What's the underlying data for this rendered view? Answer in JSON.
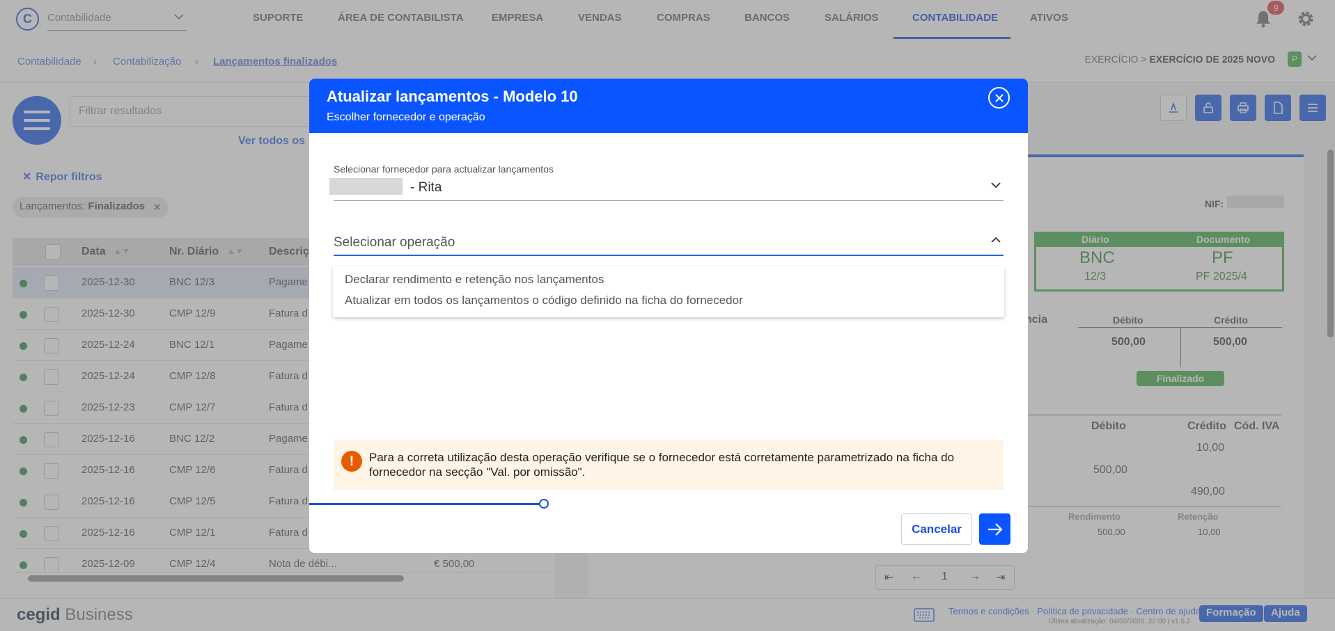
{
  "topbar": {
    "logo_letter": "C",
    "module": "Contabilidade",
    "nav": [
      "SUPORTE",
      "ÁREA DE CONTABILISTA",
      "EMPRESA",
      "VENDAS",
      "COMPRAS",
      "BANCOS",
      "SALÁRIOS",
      "CONTABILIDADE",
      "ATIVOS"
    ],
    "active_nav": "CONTABILIDADE",
    "notifications": "9"
  },
  "breadcrumb": [
    "Contabilidade",
    "Contabilização",
    "Lançamentos finalizados"
  ],
  "exercise": {
    "prefix": "EXERCÍCIO >",
    "name": "EXERCÍCIO DE 2025 NOVO",
    "badge": "P"
  },
  "left": {
    "filter_placeholder": "Filtrar resultados",
    "see_all": "Ver todos os",
    "reset_filters": "Repor filtros",
    "chip_label": "Lançamentos:",
    "chip_value": "Finalizados",
    "columns": [
      "Data",
      "Nr. Diário",
      "Descriç"
    ],
    "rows": [
      {
        "date": "2025-12-30",
        "diario": "BNC 12/3",
        "desc": "Pagame",
        "value": ""
      },
      {
        "date": "2025-12-30",
        "diario": "CMP 12/9",
        "desc": "Fatura d",
        "value": ""
      },
      {
        "date": "2025-12-24",
        "diario": "BNC 12/1",
        "desc": "Pagame",
        "value": ""
      },
      {
        "date": "2025-12-24",
        "diario": "CMP 12/8",
        "desc": "Fatura d",
        "value": ""
      },
      {
        "date": "2025-12-23",
        "diario": "CMP 12/7",
        "desc": "Fatura d",
        "value": ""
      },
      {
        "date": "2025-12-16",
        "diario": "BNC 12/2",
        "desc": "Pagame",
        "value": ""
      },
      {
        "date": "2025-12-16",
        "diario": "CMP 12/6",
        "desc": "Fatura d",
        "value": ""
      },
      {
        "date": "2025-12-16",
        "diario": "CMP 12/5",
        "desc": "Fatura d",
        "value": ""
      },
      {
        "date": "2025-12-16",
        "diario": "CMP 12/1",
        "desc": "Fatura d",
        "value": ""
      },
      {
        "date": "2025-12-09",
        "diario": "CMP 12/4",
        "desc": "Nota de débi...",
        "value": "€ 500,00"
      }
    ]
  },
  "doc": {
    "nif_label": "NIF:",
    "diario_label": "Diário",
    "documento_label": "Documento",
    "diario_code": "BNC",
    "diario_num": "12/3",
    "doc_code": "PF",
    "doc_num": "PF 2025/4",
    "ncia": "ncia",
    "debit_label": "Débito",
    "credit_label": "Crédito",
    "debit_total": "500,00",
    "credit_total": "500,00",
    "status": "Finalizado",
    "lines_debit_label": "Débito",
    "lines_credit_label": "Crédito",
    "lines_iva_label": "Cód. IVA",
    "line1_credit": "10,00",
    "line2_debit": "500,00",
    "line3_credit": "490,00",
    "rendimento_label": "Rendimento",
    "retencao_label": "Retenção",
    "rendimento_value": "500,00",
    "retencao_value": "10,00"
  },
  "pager": {
    "page": "1"
  },
  "footer": {
    "brand_bold": "cegid",
    "brand_light": "Business",
    "links": "Termos e condições · Política de privacidade · Centro de ajuda",
    "last_update": "Última atualização: 04/02/2026, 22:00 | v1.5.2",
    "training": "Formação",
    "help": "Ajuda"
  },
  "modal": {
    "title": "Atualizar lançamentos - Modelo 10",
    "subtitle": "Escolher fornecedor e operação",
    "supplier_label": "Selecionar fornecedor para actualizar lançamentos",
    "supplier_value": "- Rita",
    "operation_placeholder": "Selecionar operação",
    "options": [
      "Declarar rendimento e retenção nos lançamentos",
      "Atualizar em todos os lançamentos o código definido na ficha do fornecedor"
    ],
    "warning_icon": "!",
    "warning": "Para a correta utilização desta operação verifique se o fornecedor está corretamente parametrizado na ficha do fornecedor na secção \"Val. por omissão\".",
    "cancel": "Cancelar"
  },
  "colors": {
    "primary": "#0a55ff",
    "accent": "#2563eb",
    "success": "#4caf50",
    "warning_bg": "#fff4e5",
    "warning_icon": "#e65c00"
  }
}
